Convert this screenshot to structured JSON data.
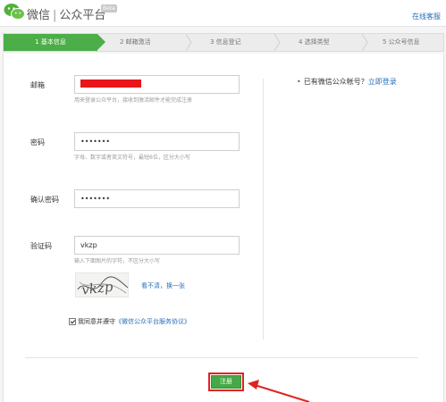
{
  "header": {
    "brand_name": "微信",
    "separator": "|",
    "platform_name": "公众平台",
    "beta_badge": "Beta",
    "online_help": "在线客服"
  },
  "steps": [
    {
      "label": "1 基本信息",
      "active": true
    },
    {
      "label": "2 邮箱激活",
      "active": false
    },
    {
      "label": "3 信息登记",
      "active": false
    },
    {
      "label": "4 选择类型",
      "active": false
    },
    {
      "label": "5 公众号信息",
      "active": false
    }
  ],
  "form": {
    "email": {
      "label": "邮箱",
      "value": "",
      "hint": "用来登录公众平台，接收到激活邮件才能完成注册"
    },
    "password": {
      "label": "密码",
      "value": "•••••••",
      "hint": "字母、数字或者英文符号，最短6位，区分大小写"
    },
    "confirm_password": {
      "label": "确认密码",
      "value": "•••••••"
    },
    "captcha": {
      "label": "验证码",
      "value": "vkzp",
      "hint": "输入下面图片的字符，不区分大小写",
      "image_text": "vkzp",
      "refresh_text": "看不清，换一张"
    },
    "agreement": {
      "prefix": "我同意并遵守",
      "link": "《微信公众平台服务协议》",
      "checked": true
    },
    "register_button": "注册"
  },
  "sidebar": {
    "bullet": "•",
    "question": "已有微信公众帐号？",
    "login_link": "立即登录"
  },
  "colors": {
    "accent_green": "#4cae48",
    "link_blue": "#2a6fb8",
    "annotation_red": "#e0231f"
  }
}
